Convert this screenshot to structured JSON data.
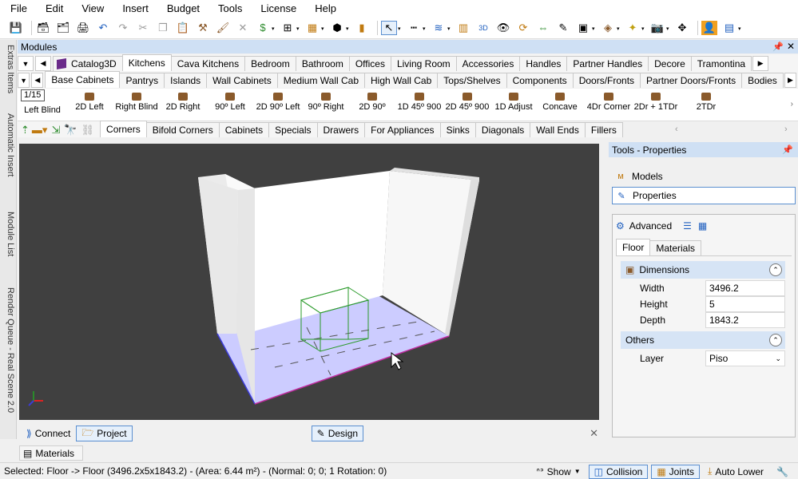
{
  "menu": [
    "File",
    "Edit",
    "View",
    "Insert",
    "Budget",
    "Tools",
    "License",
    "Help"
  ],
  "modules": {
    "title": "Modules",
    "catalog_tabs": [
      "Catalog3D",
      "Kitchens",
      "Cava Kitchens",
      "Bedroom",
      "Bathroom",
      "Offices",
      "Living Room",
      "Accessories",
      "Handles",
      "Partner Handles",
      "Decore",
      "Tramontina"
    ],
    "category_tabs": [
      "Base Cabinets",
      "Pantrys",
      "Islands",
      "Wall Cabinets",
      "Medium Wall Cab",
      "High Wall Cab",
      "Tops/Shelves",
      "Components",
      "Doors/Fronts",
      "Partner Doors/Fronts",
      "Bodies"
    ],
    "page": "1/15",
    "items": [
      "Left Blind",
      "2D Left",
      "Right Blind",
      "2D Right",
      "90º Left",
      "2D 90º Left",
      "90º Right",
      "2D 90º",
      "1D 45º 900",
      "2D 45º 900",
      "1D Adjust",
      "Concave",
      "4Dr Corner",
      "2Dr + 1TDr",
      "2TDr"
    ],
    "sub_tabs": [
      "Corners",
      "Bifold Corners",
      "Cabinets",
      "Specials",
      "Drawers",
      "For Appliances",
      "Sinks",
      "Diagonals",
      "Wall Ends",
      "Fillers"
    ]
  },
  "left_strip": [
    "Extras Items",
    "Automatic Insert",
    "Module List",
    "Render Queue - Real Scene 2.0"
  ],
  "bottom": {
    "connect": "Connect",
    "project": "Project",
    "design": "Design",
    "materials": "Materials"
  },
  "panel": {
    "title": "Tools - Properties",
    "models": "Models",
    "properties": "Properties",
    "advanced": "Advanced",
    "tabs": [
      "Floor",
      "Materials"
    ],
    "dimensions_label": "Dimensions",
    "dims": [
      {
        "label": "Width",
        "value": "3496.2"
      },
      {
        "label": "Height",
        "value": "5"
      },
      {
        "label": "Depth",
        "value": "1843.2"
      }
    ],
    "others_label": "Others",
    "layer_label": "Layer",
    "layer_value": "Piso"
  },
  "status": {
    "text": "Selected: Floor -> Floor (3496.2x5x1843.2) - (Area: 6.44 m²) - (Normal: 0; 0; 1 Rotation: 0)",
    "show": "Show",
    "collision": "Collision",
    "joints": "Joints",
    "auto_lower": "Auto Lower"
  },
  "colors": {
    "accent": "#5b8fd0",
    "header": "#cfe0f4",
    "viewport": "#404040",
    "floor": "#ccccff"
  }
}
